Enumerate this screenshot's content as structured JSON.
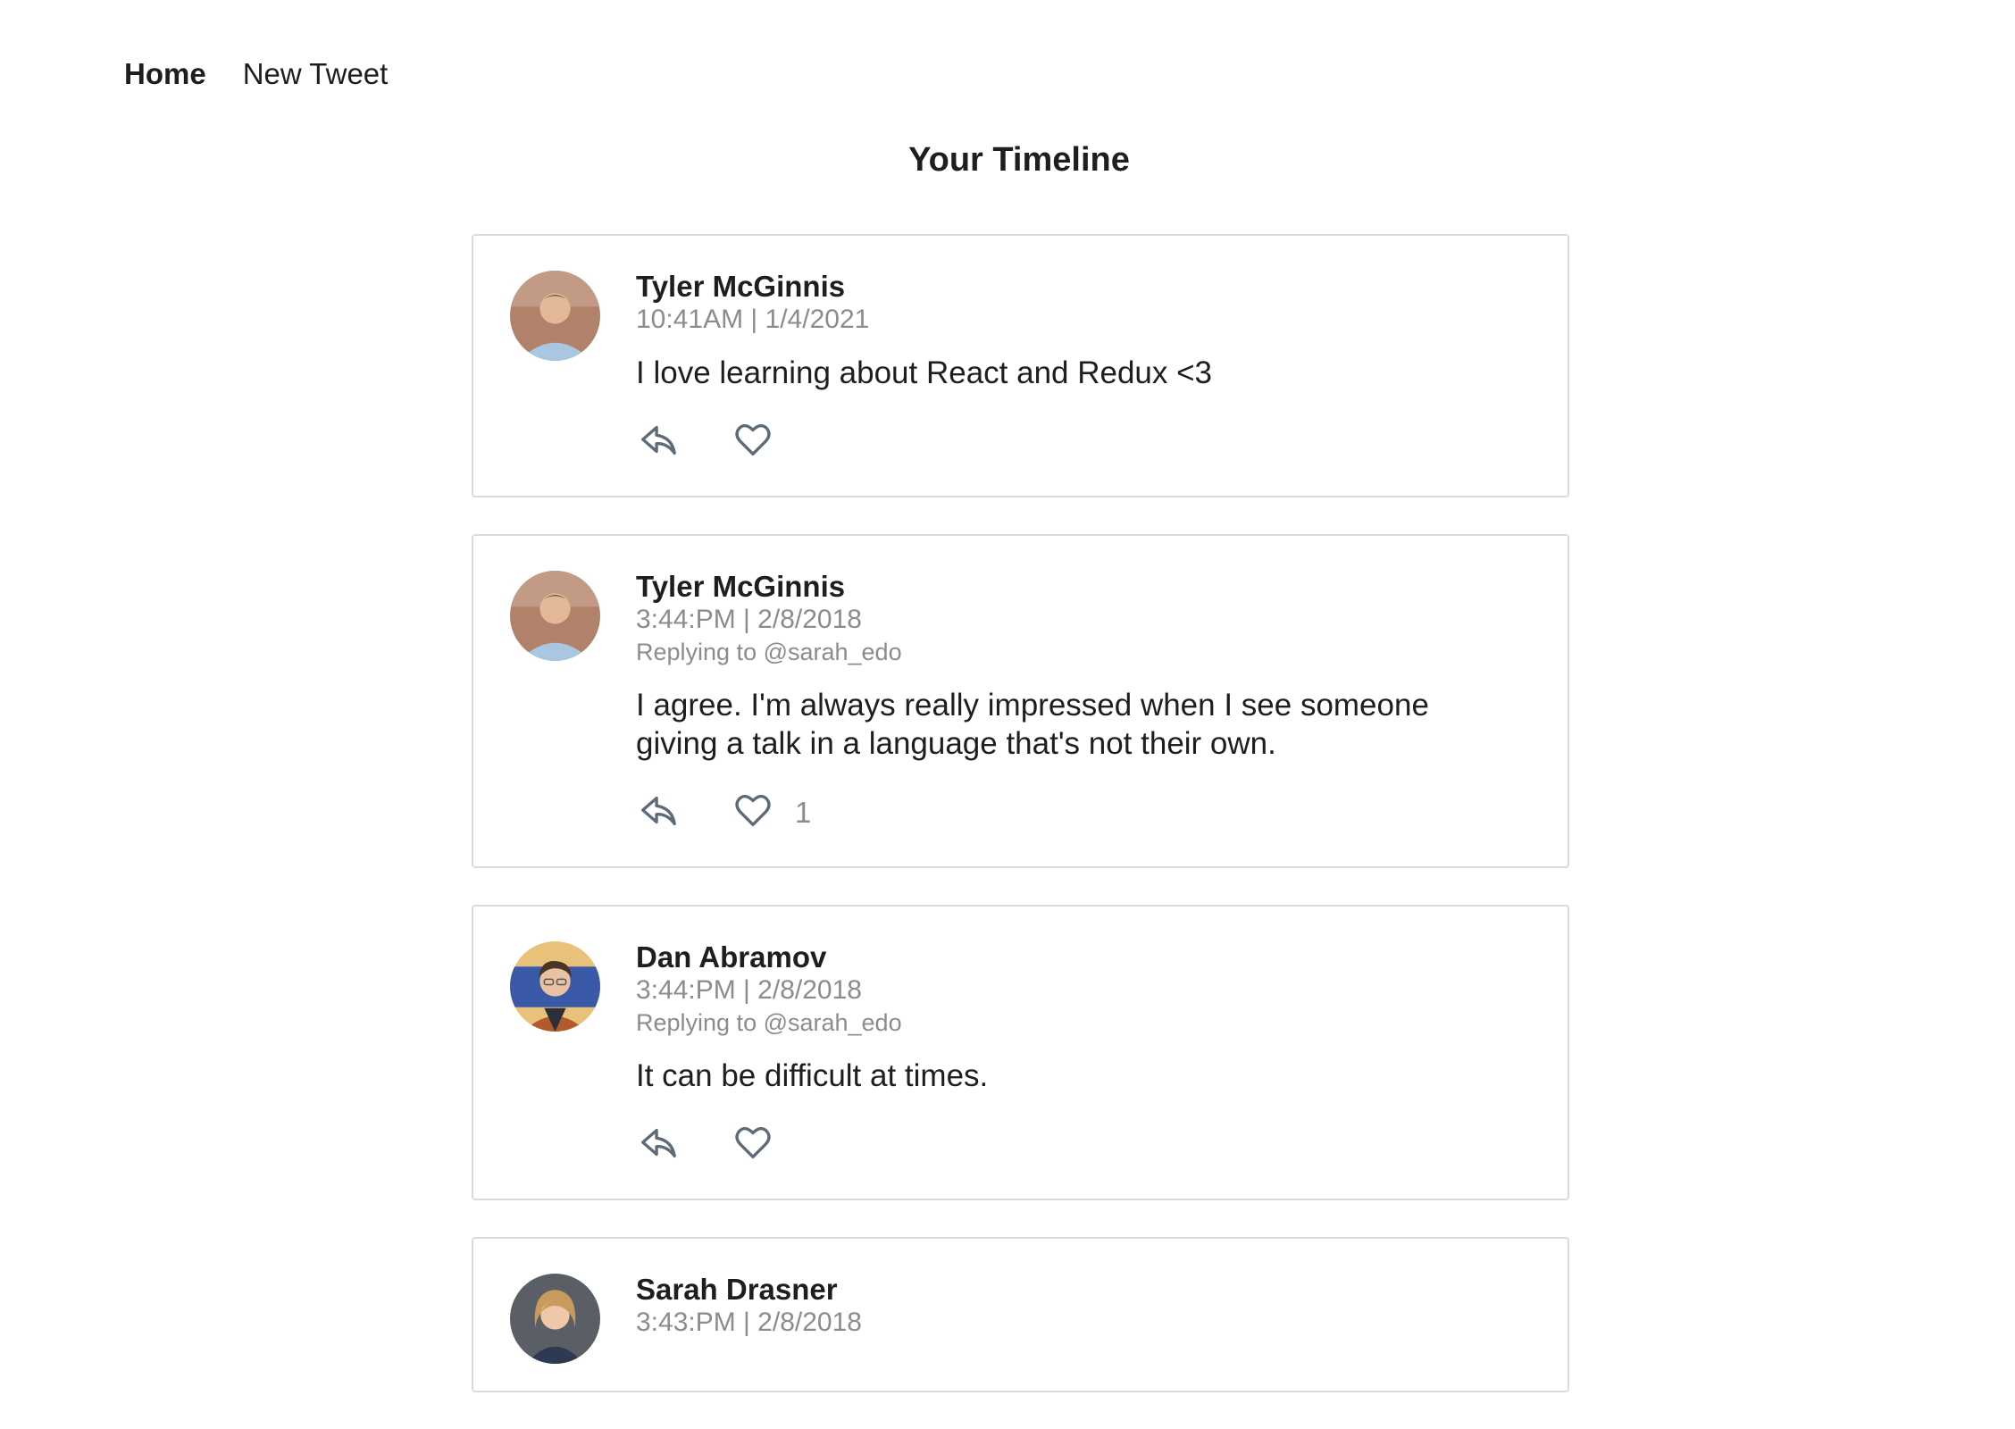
{
  "nav": {
    "home_label": "Home",
    "new_tweet_label": "New Tweet"
  },
  "page": {
    "title": "Your Timeline"
  },
  "tweets": [
    {
      "author": "Tyler McGinnis",
      "timestamp": "10:41AM | 1/4/2021",
      "replying_to": "",
      "text": "I love learning about React and Redux <3",
      "like_count": "",
      "avatar_icon": "avatar-tyler"
    },
    {
      "author": "Tyler McGinnis",
      "timestamp": "3:44:PM | 2/8/2018",
      "replying_to": "Replying to @sarah_edo",
      "text": "I agree. I'm always really impressed when I see someone giving a talk in a language that's not their own.",
      "like_count": "1",
      "avatar_icon": "avatar-tyler"
    },
    {
      "author": "Dan Abramov",
      "timestamp": "3:44:PM | 2/8/2018",
      "replying_to": "Replying to @sarah_edo",
      "text": "It can be difficult at times.",
      "like_count": "",
      "avatar_icon": "avatar-dan"
    },
    {
      "author": "Sarah Drasner",
      "timestamp": "3:43:PM | 2/8/2018",
      "replying_to": "",
      "text": "",
      "like_count": "",
      "avatar_icon": "avatar-sarah"
    }
  ],
  "icons": {
    "reply": "reply-icon",
    "like": "heart-icon"
  },
  "colors": {
    "icon_stroke": "#5e6a78",
    "meta_text": "#8c8c8c",
    "card_border": "#dadada"
  }
}
